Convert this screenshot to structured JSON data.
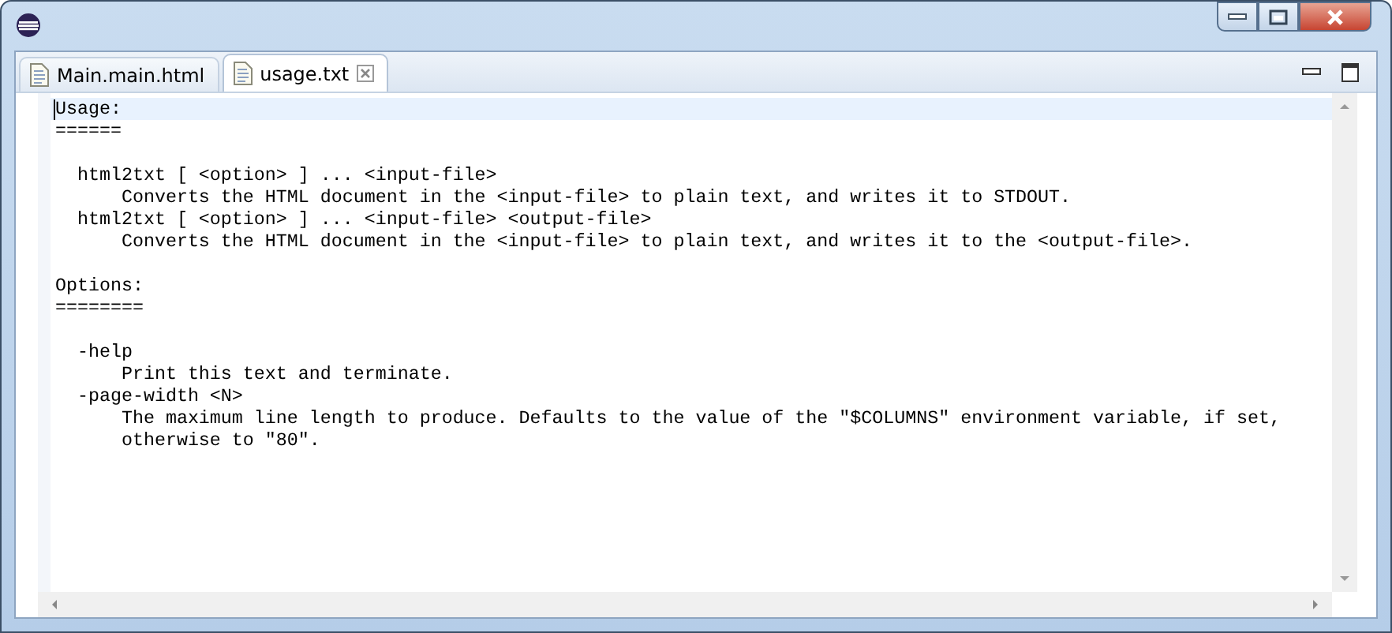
{
  "tabs": [
    {
      "label": "Main.main.html",
      "selected": false,
      "closable": false
    },
    {
      "label": "usage.txt",
      "selected": true,
      "closable": true
    }
  ],
  "editor": {
    "lines": [
      {
        "text": "Usage:",
        "current": true,
        "gap_before": false
      },
      {
        "text": "======",
        "current": false,
        "gap_before": false
      },
      {
        "text": "  html2txt [ <option> ] ... <input-file>",
        "current": false,
        "gap_before": true
      },
      {
        "text": "      Converts the HTML document in the <input-file> to plain text, and writes it to STDOUT.",
        "current": false,
        "gap_before": false
      },
      {
        "text": "  html2txt [ <option> ] ... <input-file> <output-file>",
        "current": false,
        "gap_before": false
      },
      {
        "text": "      Converts the HTML document in the <input-file> to plain text, and writes it to the <output-file>.",
        "current": false,
        "gap_before": false
      },
      {
        "text": "Options:",
        "current": false,
        "gap_before": true
      },
      {
        "text": "========",
        "current": false,
        "gap_before": false
      },
      {
        "text": "  -help",
        "current": false,
        "gap_before": true
      },
      {
        "text": "      Print this text and terminate.",
        "current": false,
        "gap_before": false
      },
      {
        "text": "  -page-width <N>",
        "current": false,
        "gap_before": false
      },
      {
        "text": "      The maximum line length to produce. Defaults to the value of the \"$COLUMNS\" environment variable, if set,",
        "current": false,
        "gap_before": false
      },
      {
        "text": "      otherwise to \"80\".",
        "current": false,
        "gap_before": false
      }
    ]
  }
}
